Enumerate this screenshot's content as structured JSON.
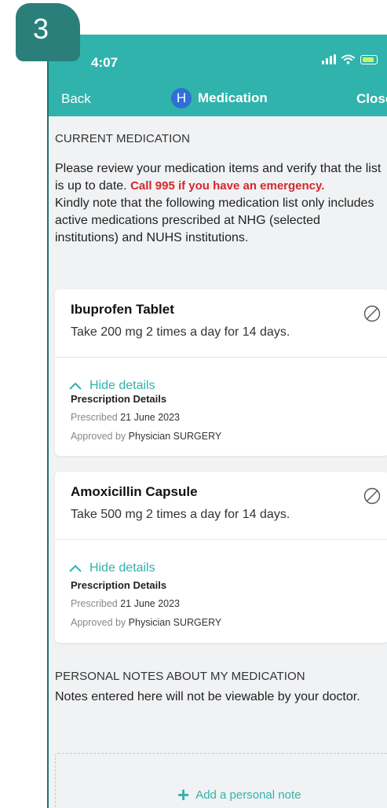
{
  "step_badge": "3",
  "status_bar": {
    "time": "4:07"
  },
  "nav": {
    "back_label": "Back",
    "logo_letter": "H",
    "title": "Medication",
    "close_label": "Close"
  },
  "current_medication": {
    "heading": "CURRENT MEDICATION",
    "intro_text": "Please review your medication items and verify that the list is up to date.",
    "emergency_text": "Call 995 if you have an emergency.",
    "note_text": "Kindly note that the following medication list only includes active medications prescribed at NHG (selected institutions) and NUHS institutions."
  },
  "medications": [
    {
      "name": "Ibuprofen Tablet",
      "dosage": "Take 200 mg 2 times a day for 14 days.",
      "toggle_label": "Hide details",
      "details_title": "Prescription Details",
      "prescribed_label": "Prescribed",
      "prescribed_date": "21 June 2023",
      "approved_label": "Approved by",
      "approved_by": "Physician SURGERY"
    },
    {
      "name": "Amoxicillin Capsule",
      "dosage": "Take 500 mg 2 times a day for 14 days.",
      "toggle_label": "Hide details",
      "details_title": "Prescription Details",
      "prescribed_label": "Prescribed",
      "prescribed_date": "21 June 2023",
      "approved_label": "Approved by",
      "approved_by": "Physician SURGERY"
    }
  ],
  "personal_notes": {
    "heading": "PERSONAL NOTES ABOUT MY MEDICATION",
    "description": "Notes entered here will not be viewable by your doctor.",
    "add_label": "Add a personal note"
  },
  "colors": {
    "header_teal": "#2fb3ac",
    "badge_teal": "#2a7f7b",
    "emergency_red": "#d7262c",
    "logo_blue": "#2f6fd6"
  },
  "icons": [
    "signal-icon",
    "wifi-icon",
    "battery-icon",
    "h-logo-icon",
    "stop-icon",
    "chevron-up-icon",
    "plus-icon"
  ]
}
